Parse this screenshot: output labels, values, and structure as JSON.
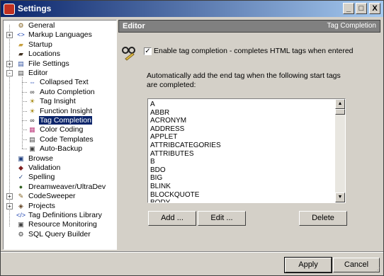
{
  "window": {
    "title": "Settings",
    "minimize": "_",
    "maximize": "□",
    "close": "X"
  },
  "tree": {
    "items": [
      {
        "label": "General",
        "icon": "gear-icon",
        "glyph": "⚙",
        "color": "#806020",
        "level": 0,
        "expander": ""
      },
      {
        "label": "Markup Languages",
        "icon": "markup-icon",
        "glyph": "<>",
        "color": "#1a40b0",
        "level": 0,
        "expander": "+"
      },
      {
        "label": "Startup",
        "icon": "folder-icon",
        "glyph": "▰",
        "color": "#c8a040",
        "level": 0,
        "expander": ""
      },
      {
        "label": "Locations",
        "icon": "folder-icon",
        "glyph": "▰",
        "color": "#403020",
        "level": 0,
        "expander": ""
      },
      {
        "label": "File Settings",
        "icon": "file-settings-icon",
        "glyph": "▤",
        "color": "#3050a0",
        "level": 0,
        "expander": "+"
      },
      {
        "label": "Editor",
        "icon": "editor-icon",
        "glyph": "▤",
        "color": "#404040",
        "level": 0,
        "expander": "-"
      },
      {
        "label": "Collapsed Text",
        "icon": "collapsed-text-icon",
        "glyph": "⇔",
        "color": "#1a40b0",
        "level": 1,
        "expander": ""
      },
      {
        "label": "Auto Completion",
        "icon": "glasses-icon",
        "glyph": "∞",
        "color": "#202020",
        "level": 1,
        "expander": ""
      },
      {
        "label": "Tag Insight",
        "icon": "bulb-icon",
        "glyph": "☀",
        "color": "#a08000",
        "level": 1,
        "expander": ""
      },
      {
        "label": "Function Insight",
        "icon": "bulb-icon",
        "glyph": "☀",
        "color": "#a08000",
        "level": 1,
        "expander": ""
      },
      {
        "label": "Tag Completion",
        "icon": "glasses-icon",
        "glyph": "∞",
        "color": "#202020",
        "level": 1,
        "expander": "",
        "selected": true
      },
      {
        "label": "Color Coding",
        "icon": "color-coding-icon",
        "glyph": "▦",
        "color": "#c04080",
        "level": 1,
        "expander": ""
      },
      {
        "label": "Code Templates",
        "icon": "code-templates-icon",
        "glyph": "▤",
        "color": "#404040",
        "level": 1,
        "expander": ""
      },
      {
        "label": "Auto-Backup",
        "icon": "backup-icon",
        "glyph": "▣",
        "color": "#404040",
        "level": 1,
        "expander": ""
      },
      {
        "label": "Browse",
        "icon": "browse-icon",
        "glyph": "▣",
        "color": "#204080",
        "level": 0,
        "expander": ""
      },
      {
        "label": "Validation",
        "icon": "validation-icon",
        "glyph": "◆",
        "color": "#802020",
        "level": 0,
        "expander": ""
      },
      {
        "label": "Spelling",
        "icon": "spelling-icon",
        "glyph": "✓",
        "color": "#204080",
        "level": 0,
        "expander": ""
      },
      {
        "label": "Dreamweaver/UltraDev",
        "icon": "dreamweaver-icon",
        "glyph": "●",
        "color": "#306020",
        "level": 0,
        "expander": ""
      },
      {
        "label": "CodeSweeper",
        "icon": "codesweeper-icon",
        "glyph": "✎",
        "color": "#806020",
        "level": 0,
        "expander": "+"
      },
      {
        "label": "Projects",
        "icon": "projects-icon",
        "glyph": "◈",
        "color": "#604020",
        "level": 0,
        "expander": "+"
      },
      {
        "label": "Tag Definitions Library",
        "icon": "tag-library-icon",
        "glyph": "</>",
        "color": "#1a40b0",
        "level": 0,
        "expander": ""
      },
      {
        "label": "Resource Monitoring",
        "icon": "monitor-icon",
        "glyph": "▣",
        "color": "#404040",
        "level": 0,
        "expander": ""
      },
      {
        "label": "SQL Query Builder",
        "icon": "sql-icon",
        "glyph": "⚙",
        "color": "#404040",
        "level": 0,
        "expander": ""
      }
    ]
  },
  "panel": {
    "header_left": "Editor",
    "header_right": "Tag Completion",
    "enable_label": "Enable tag completion - completes HTML tags when entered",
    "enable_checked": true,
    "description": "Automatically add the end tag when the following start tags are completed:",
    "tags": [
      "A",
      "ABBR",
      "ACRONYM",
      "ADDRESS",
      "APPLET",
      "ATTRIBCATEGORIES",
      "ATTRIBUTES",
      "B",
      "BDO",
      "BIG",
      "BLINK",
      "BLOCKQUOTE",
      "BODY"
    ],
    "add_label": "Add ...",
    "edit_label": "Edit ...",
    "delete_label": "Delete"
  },
  "footer": {
    "apply_label": "Apply",
    "cancel_label": "Cancel"
  }
}
